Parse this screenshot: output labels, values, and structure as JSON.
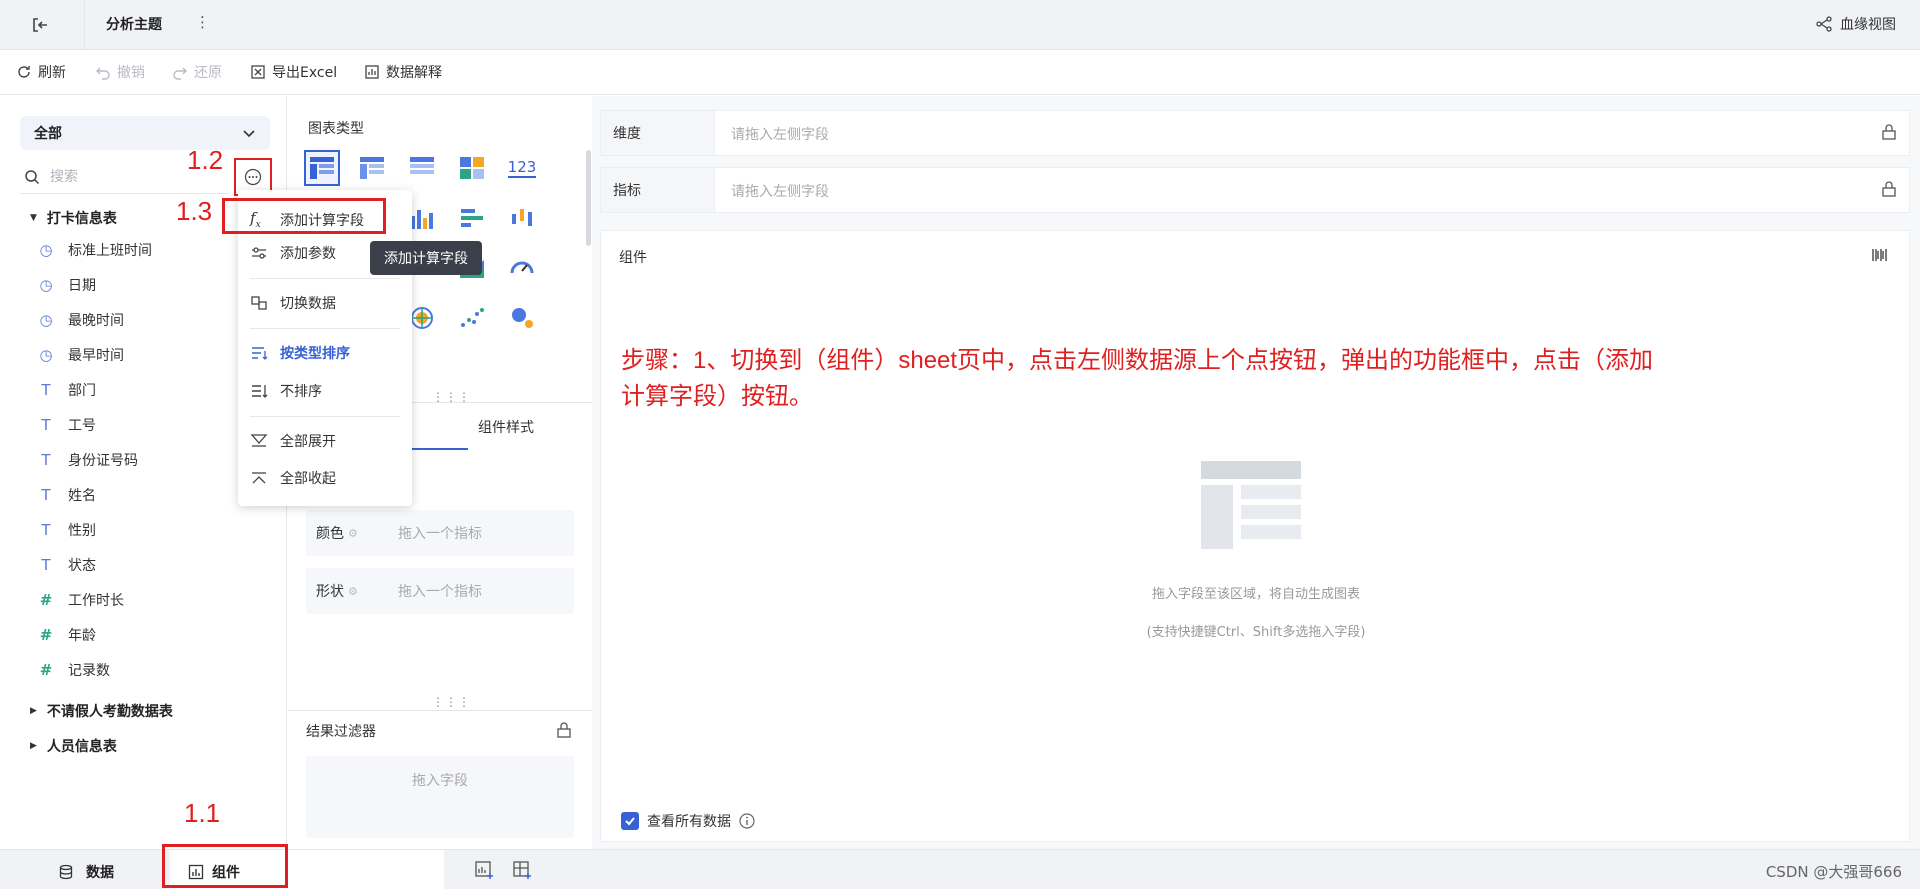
{
  "header": {
    "title": "分析主题",
    "more_glyph": "⋮",
    "lineage_label": "血缘视图"
  },
  "toolbar": {
    "refresh": "刷新",
    "undo": "撤销",
    "redo": "还原",
    "export": "导出Excel",
    "explain": "数据解释"
  },
  "left": {
    "datasource": "全部",
    "search_placeholder": "搜索",
    "groups": [
      {
        "name": "打卡信息表"
      },
      {
        "name": "不请假人考勤数据表"
      },
      {
        "name": "人员信息表"
      }
    ],
    "fields": [
      {
        "name": "标准上班时间",
        "icon": "clock-icon"
      },
      {
        "name": "日期",
        "icon": "clock-icon"
      },
      {
        "name": "最晚时间",
        "icon": "clock-icon"
      },
      {
        "name": "最早时间",
        "icon": "clock-icon"
      },
      {
        "name": "部门",
        "icon": "text-icon"
      },
      {
        "name": "工号",
        "icon": "text-icon"
      },
      {
        "name": "身份证号码",
        "icon": "text-icon"
      },
      {
        "name": "姓名",
        "icon": "text-icon"
      },
      {
        "name": "性别",
        "icon": "text-icon"
      },
      {
        "name": "状态",
        "icon": "text-icon"
      },
      {
        "name": "工作时长",
        "icon": "number-icon"
      },
      {
        "name": "年龄",
        "icon": "number-icon"
      },
      {
        "name": "记录数",
        "icon": "number-icon"
      }
    ]
  },
  "annotations": {
    "a11": "1.1",
    "a12": "1.2",
    "a13": "1.3"
  },
  "menu": {
    "items": [
      {
        "label": "添加计算字段"
      },
      {
        "label": "添加参数"
      },
      {
        "label": "切换数据"
      },
      {
        "label": "按类型排序"
      },
      {
        "label": "不排序"
      },
      {
        "label": "全部展开"
      },
      {
        "label": "全部收起"
      }
    ],
    "tooltip": "添加计算字段"
  },
  "middle": {
    "chart_type_label": "图表类型",
    "tab_style": "组件样式",
    "color_label": "颜色",
    "shape_label": "形状",
    "drop_metric_placeholder": "拖入一个指标",
    "filter_title": "结果过滤器",
    "filter_placeholder": "拖入字段",
    "number_chart_label": "123"
  },
  "right": {
    "dimension_label": "维度",
    "metric_label": "指标",
    "shelf_placeholder": "请拖入左侧字段",
    "canvas_title": "组件",
    "step_text": "步骤：1、切换到（组件）sheet页中，点击左侧数据源上个点按钮，弹出的功能框中，点击（添加计算字段）按钮。",
    "empty_line1": "拖入字段至该区域，将自动生成图表",
    "empty_line2": "(支持快捷键Ctrl、Shift多选拖入字段)",
    "view_all_label": "查看所有数据"
  },
  "bottom": {
    "tab_data": "数据",
    "tab_component": "组件",
    "watermark": "CSDN @大强哥666"
  },
  "colors": {
    "accent": "#3762d6",
    "annotation_red": "#e02020"
  }
}
